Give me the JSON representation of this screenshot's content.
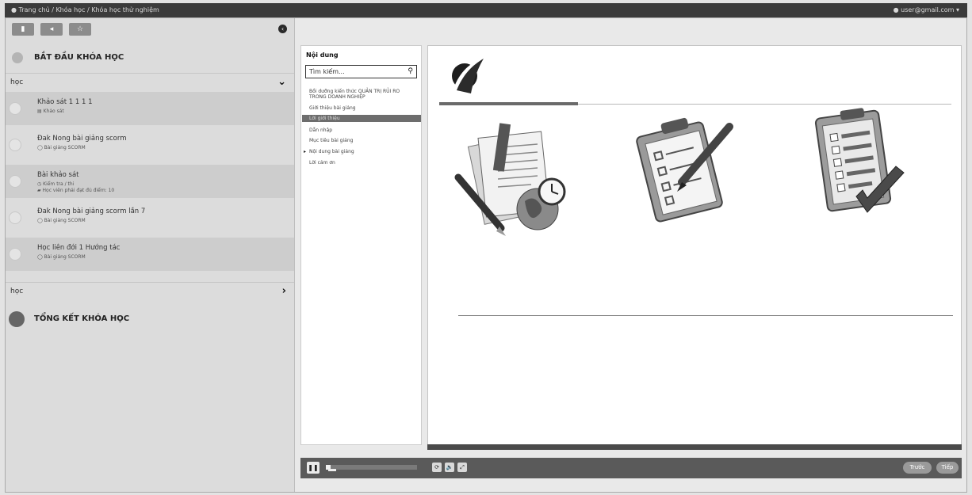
{
  "topbar": {
    "breadcrumb": "● Trang chủ  /  Khóa học  /  Khóa học thử nghiệm",
    "user": "● user@gmail.com ▾"
  },
  "sidebar": {
    "tabs": [
      "▮",
      "◂",
      "☆"
    ],
    "collapse_icon": "‹",
    "start_section": "BẮT ĐẦU KHÓA HỌC",
    "group1": {
      "label": "học",
      "chevron": "⌄"
    },
    "lessons": [
      {
        "title": "Khảo sát 1 1 1 1",
        "meta": "▤ Khảo sát",
        "meta2": ""
      },
      {
        "title": "Đak Nong bài giảng scorm",
        "meta": "◯ Bài giảng SCORM",
        "meta2": ""
      },
      {
        "title": "Bài khảo sát",
        "meta": "◷ Kiểm tra / thi",
        "meta2": "▰ Học viên phải đạt đủ điểm: 10"
      },
      {
        "title": "Đak Nong bài giảng scorm lần 7",
        "meta": "◯ Bài giảng SCORM",
        "meta2": ""
      },
      {
        "title": "Học liên đới 1 Hướng tác",
        "meta": "◯ Bài giảng SCORM",
        "meta2": ""
      }
    ],
    "group2": {
      "label": "học",
      "chevron": "›"
    },
    "end_section": "TỔNG KẾT KHÓA HỌC"
  },
  "toc": {
    "heading": "Nội dung",
    "search_placeholder": "Tìm kiếm...",
    "search_icon": "⚲",
    "items": [
      {
        "label": "Bồi dưỡng kiến thức QUẢN TRỊ RỦI RO TRONG DOANH NGHIỆP",
        "selected": false,
        "arrow": false
      },
      {
        "label": "Giới thiệu bài giảng",
        "selected": false,
        "arrow": false
      },
      {
        "label": "Lời giới thiệu",
        "selected": true,
        "arrow": false
      },
      {
        "label": "Dẫn nhập",
        "selected": false,
        "arrow": false
      },
      {
        "label": "Mục tiêu bài giảng",
        "selected": false,
        "arrow": false
      },
      {
        "label": "Nội dung bài giảng",
        "selected": false,
        "arrow": true
      },
      {
        "label": "Lời cảm ơn",
        "selected": false,
        "arrow": false
      }
    ]
  },
  "player": {
    "pause_icon": "❚❚",
    "progress_fraction": 0.05,
    "icon_buttons": [
      "⟳",
      "🔈",
      "⤢"
    ],
    "prev_label": "Trước",
    "next_label": "Tiếp"
  },
  "colors": {
    "logo": "#1e1e1e",
    "topbar": "#3b3b3b"
  }
}
